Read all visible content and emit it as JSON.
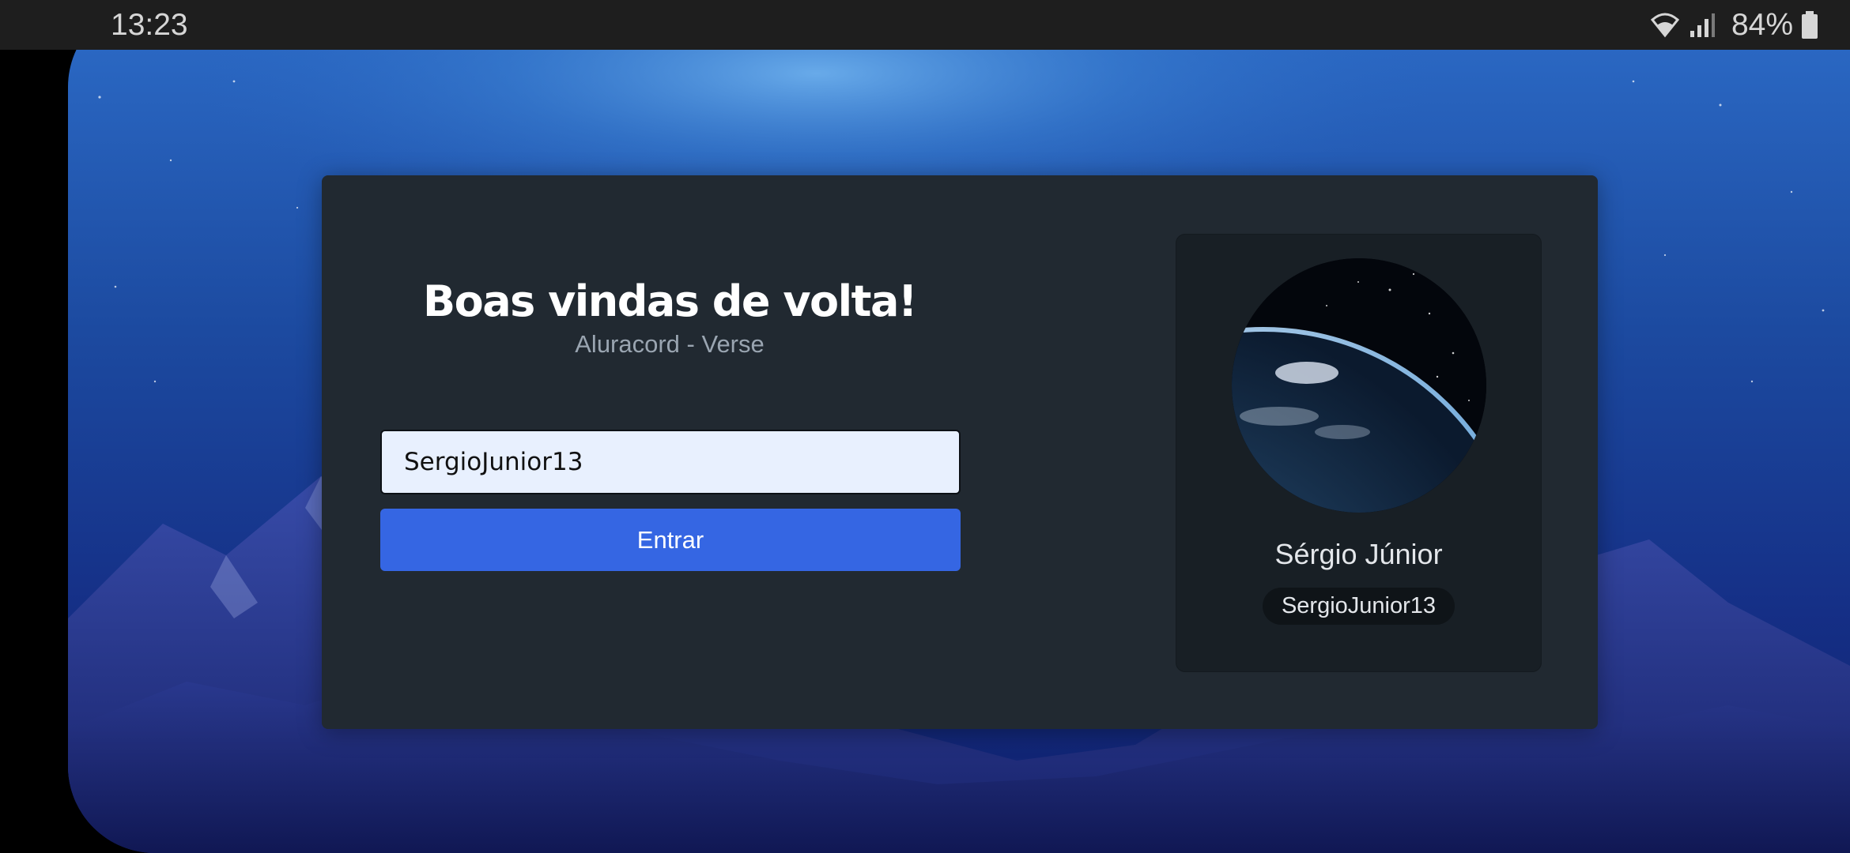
{
  "status_bar": {
    "time": "13:23",
    "battery_percent": "84%",
    "icons": [
      "wifi-icon",
      "signal-icon",
      "battery-icon"
    ]
  },
  "login": {
    "title": "Boas vindas de volta!",
    "subtitle": "Aluracord - Verse",
    "username_value": "SergioJunior13",
    "enter_button_label": "Entrar"
  },
  "profile": {
    "display_name": "Sérgio Júnior",
    "username": "SergioJunior13"
  },
  "colors": {
    "card_background": "#212931",
    "panel_background": "#181f25",
    "primary_button": "#3566e3",
    "input_background": "#e8f0fe"
  }
}
